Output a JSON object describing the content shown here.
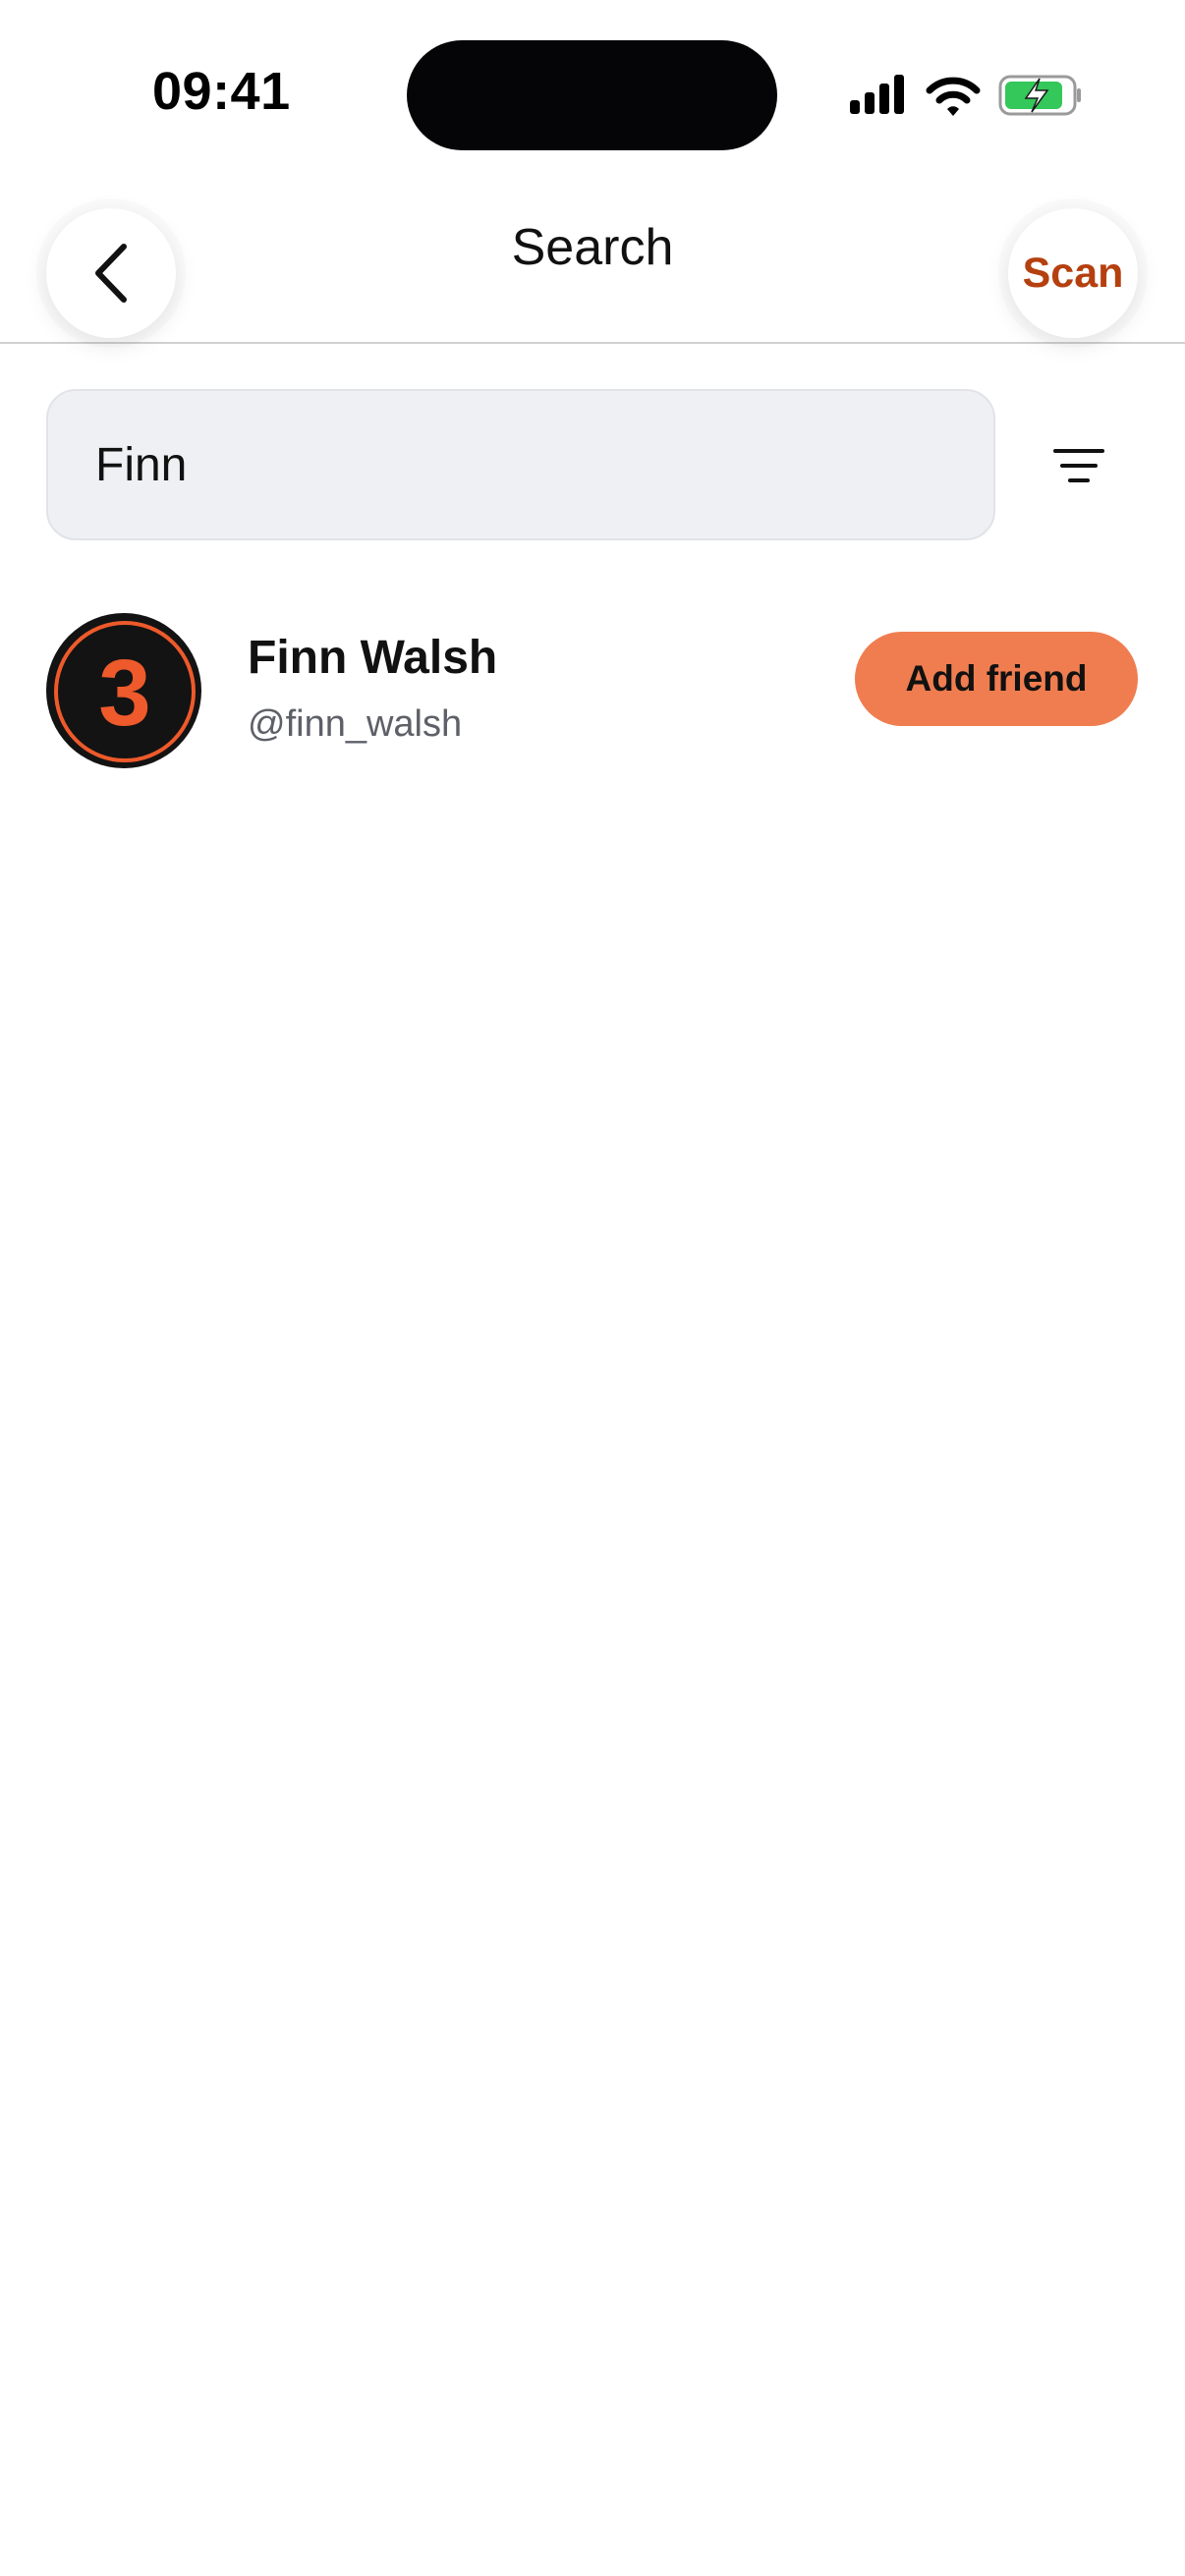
{
  "status_bar": {
    "time": "09:41",
    "icons": [
      "cellular-signal-icon",
      "wifi-icon",
      "battery-charging-icon"
    ],
    "battery_color": "#34C759"
  },
  "nav": {
    "title": "Search",
    "back_icon": "chevron-left-icon",
    "scan_label": "Scan"
  },
  "search": {
    "value": "Finn",
    "placeholder": "",
    "filter_icon": "filter-icon"
  },
  "results": [
    {
      "avatar_digit": "3",
      "name": "Finn Walsh",
      "handle": "@finn_walsh",
      "action_label": "Add friend"
    }
  ],
  "colors": {
    "accent": "#F07D50",
    "scan_text": "#B5400F",
    "avatar_bg": "#131313",
    "avatar_digit": "#EE5A2B"
  }
}
